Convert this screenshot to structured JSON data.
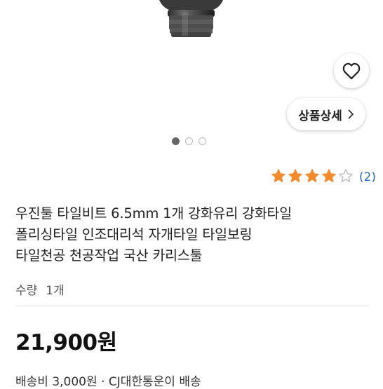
{
  "product": {
    "image_icon": "tile-drill-bit-image",
    "wish_icon": "heart-outline-icon",
    "detail_label": "상품상세",
    "detail_icon": "chevron-right-icon",
    "carousel": {
      "total": 3,
      "active": 1
    },
    "rating": {
      "stars": 4,
      "max": 5,
      "count_text": "(2)",
      "star_color": "#f28a2e"
    },
    "title_lines": [
      "우진툴 타일비트 6.5mm 1개 강화유리 강화타일",
      "폴리싱타일 인조대리석 자개타일 타일보링",
      "타일천공 천공작업 국산 카리스툴"
    ],
    "quantity_label": "수량",
    "quantity_value": "1개",
    "price": "21,900원",
    "shipping_text": "배송비 3,000원 · CJ대한통운이 배송"
  }
}
